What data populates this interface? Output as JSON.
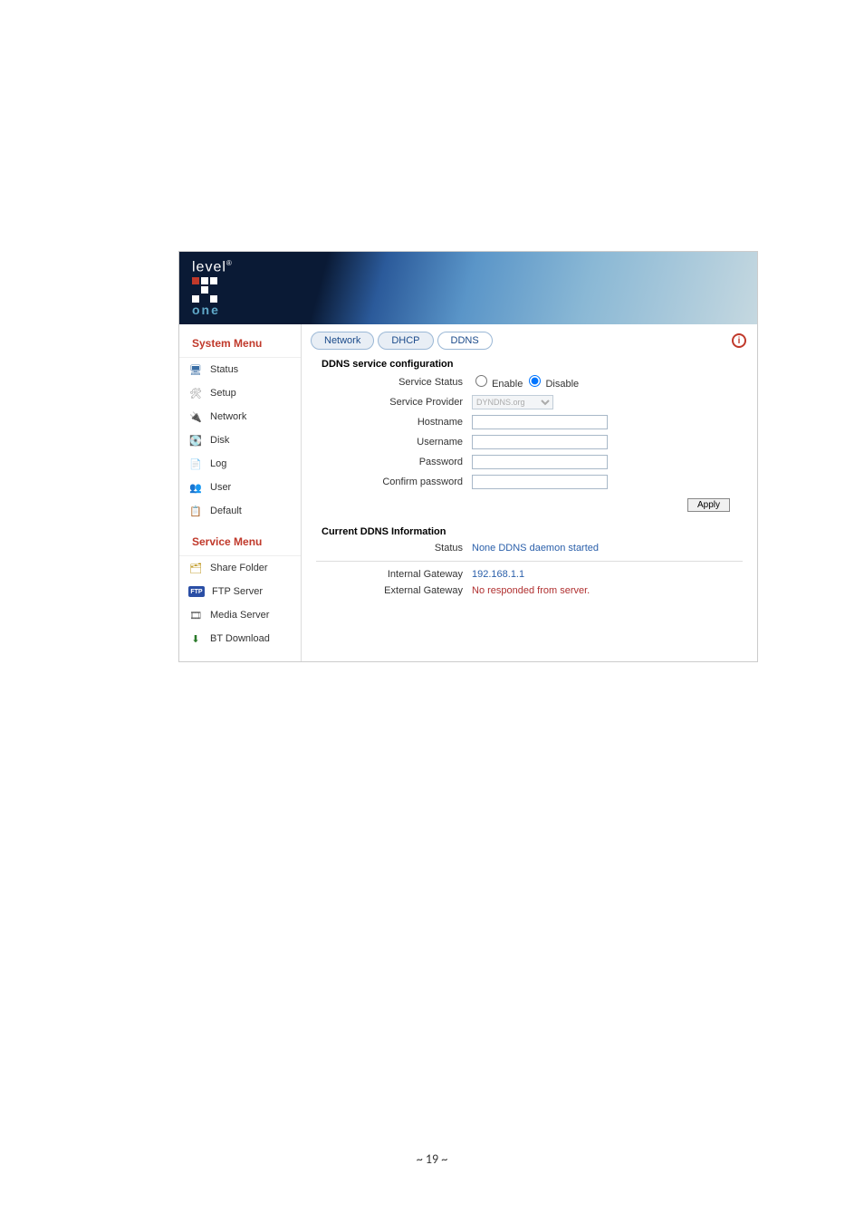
{
  "logo": {
    "brand": "level",
    "sub": "one"
  },
  "sidebar": {
    "system_head": "System Menu",
    "service_head": "Service Menu",
    "status": "Status",
    "setup": "Setup",
    "network": "Network",
    "disk": "Disk",
    "log": "Log",
    "user": "User",
    "default": "Default",
    "share": "Share Folder",
    "ftp": "FTP Server",
    "media": "Media Server",
    "bt": "BT Download"
  },
  "tabs": {
    "network": "Network",
    "dhcp": "DHCP",
    "ddns": "DDNS"
  },
  "ddns_config": {
    "title": "DDNS service configuration",
    "service_status_lbl": "Service Status",
    "enable": "Enable",
    "disable": "Disable",
    "service_provider_lbl": "Service Provider",
    "provider_val": "DYNDNS.org",
    "hostname_lbl": "Hostname",
    "username_lbl": "Username",
    "password_lbl": "Password",
    "confirm_lbl": "Confirm password",
    "apply": "Apply"
  },
  "ddns_info": {
    "title": "Current DDNS Information",
    "status_lbl": "Status",
    "status_val": "None DDNS daemon started",
    "int_gw_lbl": "Internal Gateway",
    "int_gw_val": "192.168.1.1",
    "ext_gw_lbl": "External Gateway",
    "ext_gw_val": "No responded from server."
  },
  "info_icon": "i",
  "ftp_badge": "FTP",
  "page_num": "~ 19 ~"
}
